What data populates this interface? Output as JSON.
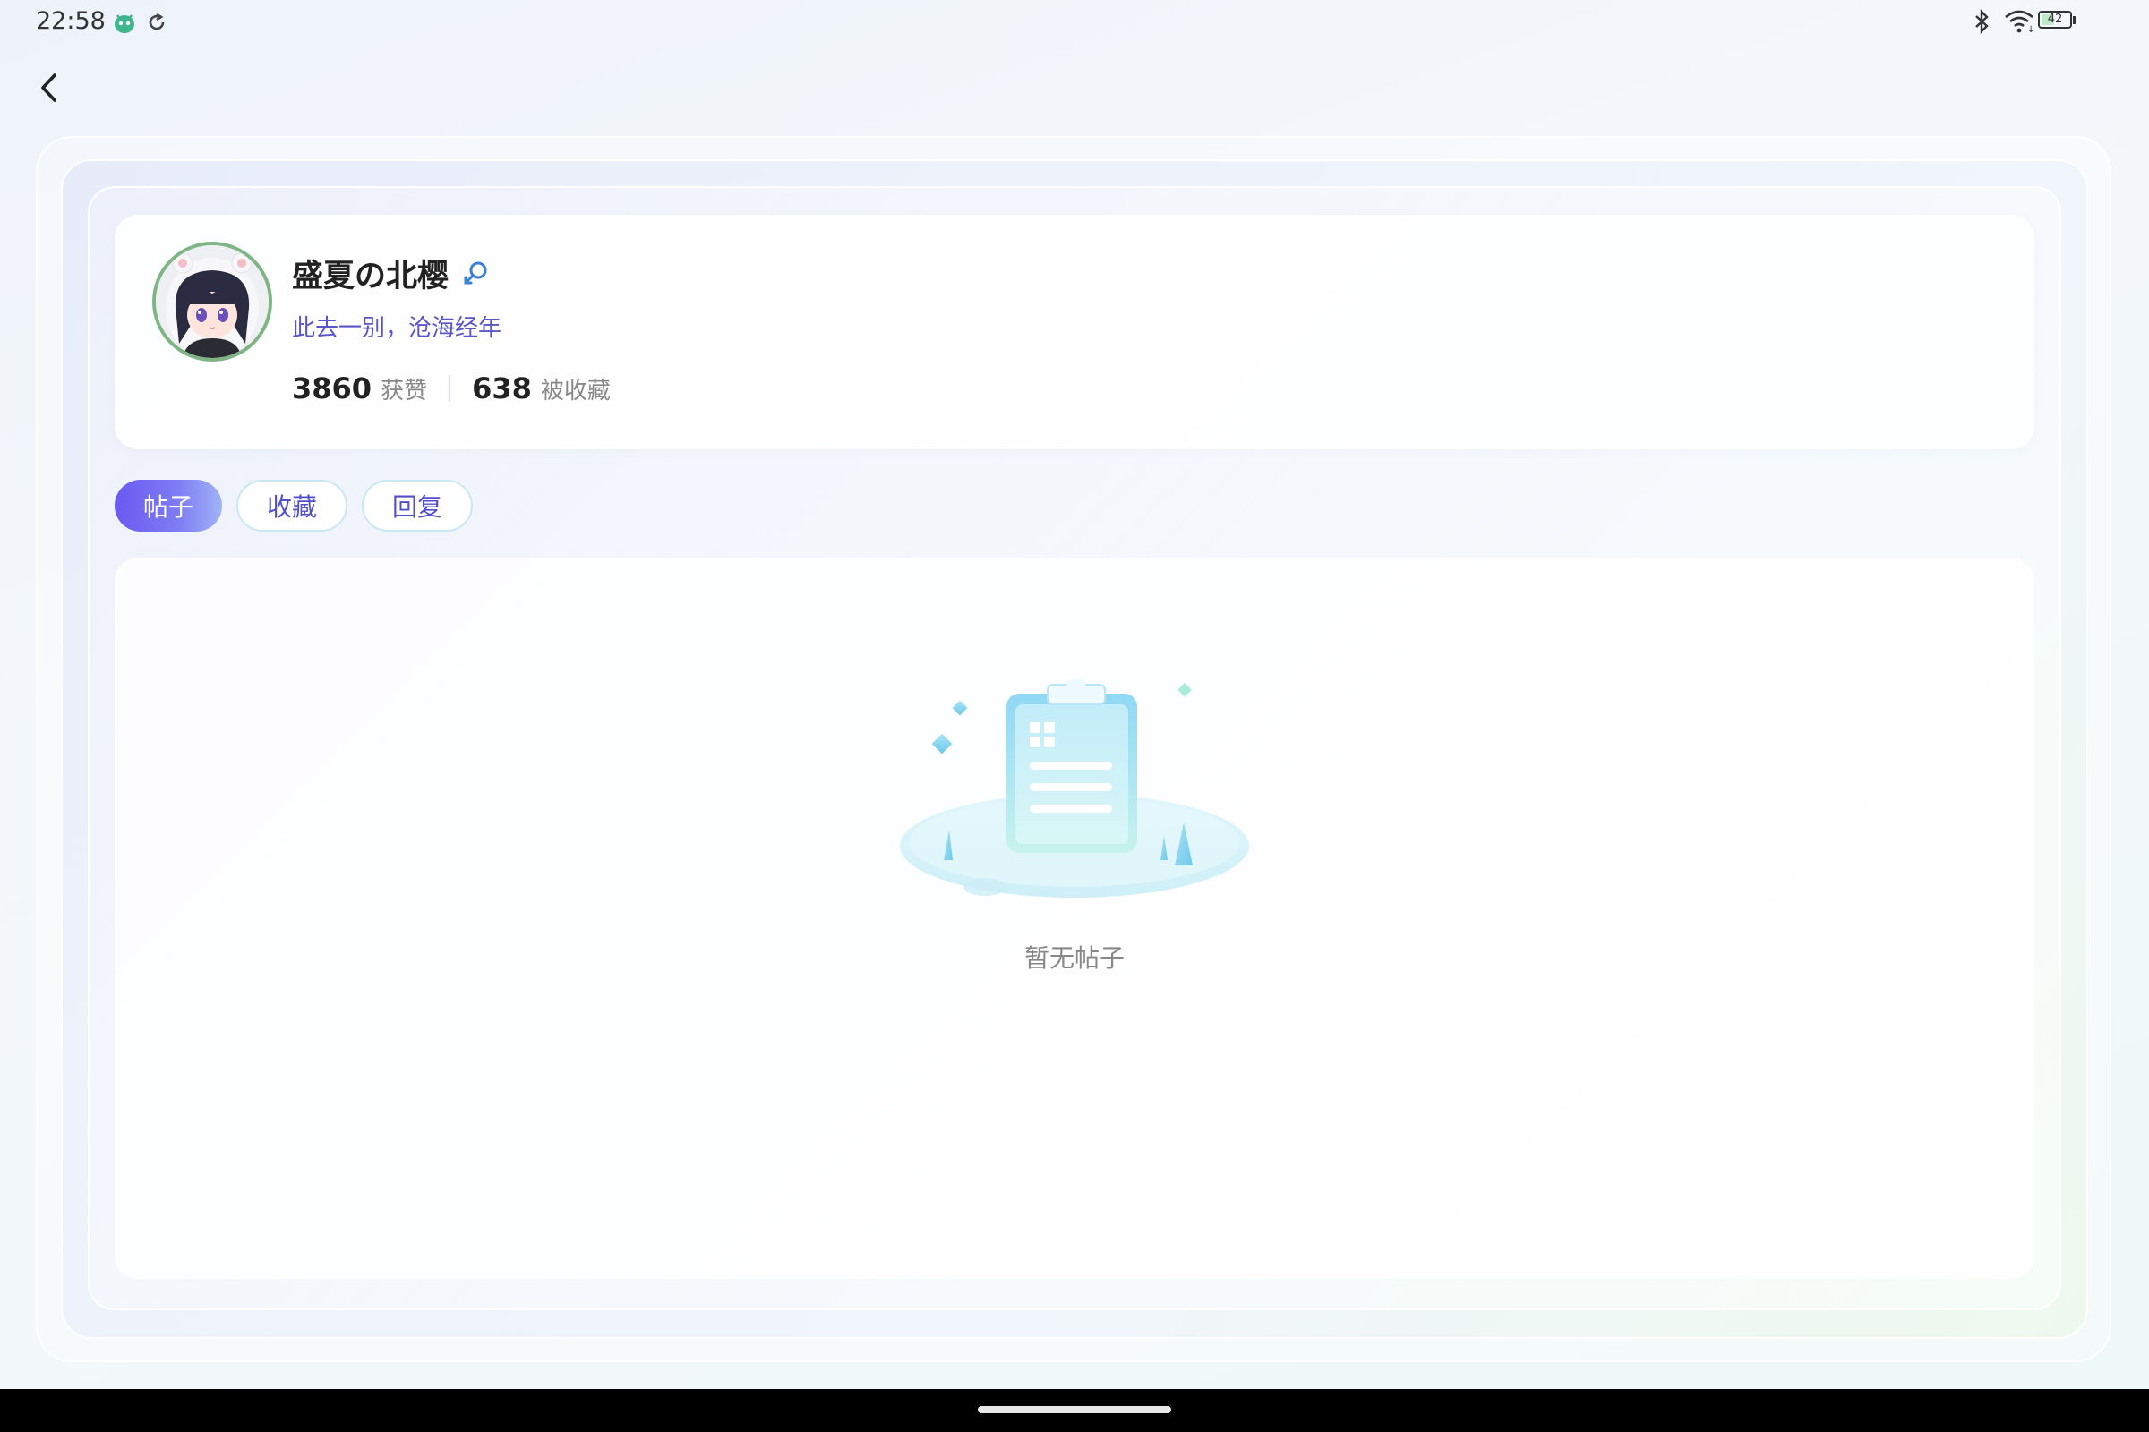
{
  "status_bar": {
    "time": "22:58",
    "battery_level": "42",
    "app_icon": "android-app-icon",
    "sync_icon": "sync-icon",
    "bluetooth_icon": "bluetooth-icon",
    "wifi_icon": "wifi-icon"
  },
  "header": {
    "back_icon": "chevron-left-icon"
  },
  "profile": {
    "username": "盛夏の北樱",
    "gender_icon": "female-icon",
    "bio": "此去一别，沧海经年",
    "stats": [
      {
        "value": "3860",
        "label": "获赞"
      },
      {
        "value": "638",
        "label": "被收藏"
      }
    ]
  },
  "tabs": [
    {
      "label": "帖子",
      "active": true
    },
    {
      "label": "收藏",
      "active": false
    },
    {
      "label": "回复",
      "active": false
    }
  ],
  "empty_state": {
    "message": "暂无帖子",
    "illustration": "clipboard-illustration"
  },
  "colors": {
    "accent": "#6a59f0",
    "bio_text": "#5a55c8",
    "tab_text": "#5250c8"
  }
}
